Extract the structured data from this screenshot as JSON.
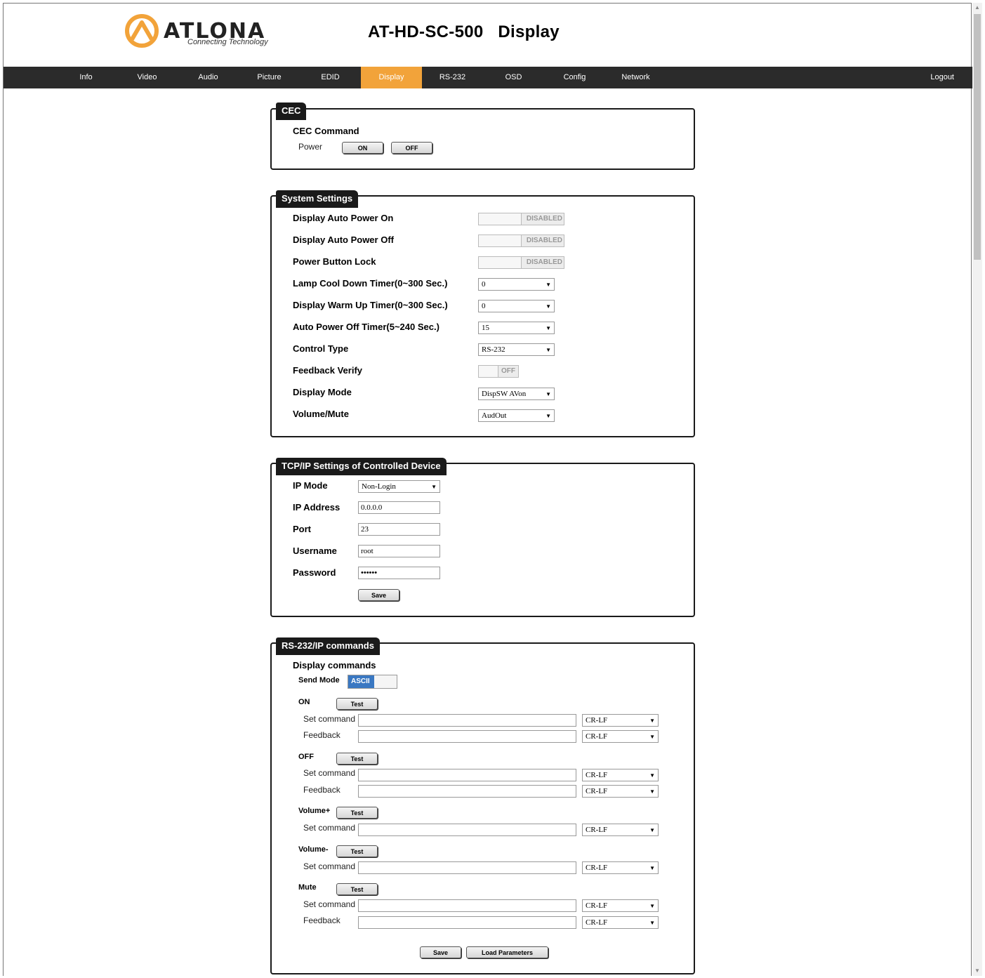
{
  "header": {
    "logo_word": "ATLONA",
    "logo_tagline": "Connecting Technology",
    "title": "AT-HD-SC-500   Display",
    "brand_color": "#f2a33a"
  },
  "nav": {
    "items": [
      "Info",
      "Video",
      "Audio",
      "Picture",
      "EDID",
      "Display",
      "RS-232",
      "OSD",
      "Config",
      "Network"
    ],
    "active": "Display",
    "logout": "Logout"
  },
  "cec": {
    "tab": "CEC",
    "command_label": "CEC Command",
    "power_label": "Power",
    "on_button": "ON",
    "off_button": "OFF"
  },
  "system": {
    "tab": "System Settings",
    "rows": [
      {
        "label": "Display Auto Power On",
        "control": "toggle",
        "value": "DISABLED"
      },
      {
        "label": "Display Auto Power Off",
        "control": "toggle",
        "value": "DISABLED"
      },
      {
        "label": "Power Button Lock",
        "control": "toggle",
        "value": "DISABLED"
      },
      {
        "label": "Lamp Cool Down Timer(0~300 Sec.)",
        "control": "select",
        "value": "0"
      },
      {
        "label": "Display Warm Up Timer(0~300 Sec.)",
        "control": "select",
        "value": "0"
      },
      {
        "label": "Auto Power Off Timer(5~240 Sec.)",
        "control": "select",
        "value": "15"
      },
      {
        "label": "Control Type",
        "control": "select",
        "value": "RS-232"
      },
      {
        "label": "Feedback Verify",
        "control": "toggle-small",
        "value": "OFF"
      },
      {
        "label": "Display Mode",
        "control": "select",
        "value": "DispSW AVon"
      },
      {
        "label": "Volume/Mute",
        "control": "select",
        "value": "AudOut"
      }
    ]
  },
  "tcpip": {
    "tab": "TCP/IP Settings of Controlled Device",
    "ip_mode_label": "IP Mode",
    "ip_mode_value": "Non-Login",
    "ip_address_label": "IP Address",
    "ip_address_value": "0.0.0.0",
    "port_label": "Port",
    "port_value": "23",
    "username_label": "Username",
    "username_value": "root",
    "password_label": "Password",
    "password_value": "••••••",
    "save_button": "Save"
  },
  "commands": {
    "tab": "RS-232/IP commands",
    "heading": "Display commands",
    "send_mode_label": "Send Mode",
    "send_mode_value": "ASCII",
    "test_button": "Test",
    "set_command_label": "Set command",
    "feedback_label": "Feedback",
    "terminator": "CR-LF",
    "groups": [
      "ON",
      "OFF",
      "Volume+",
      "Volume-",
      "Mute"
    ],
    "save_button": "Save",
    "load_button": "Load Parameters"
  }
}
